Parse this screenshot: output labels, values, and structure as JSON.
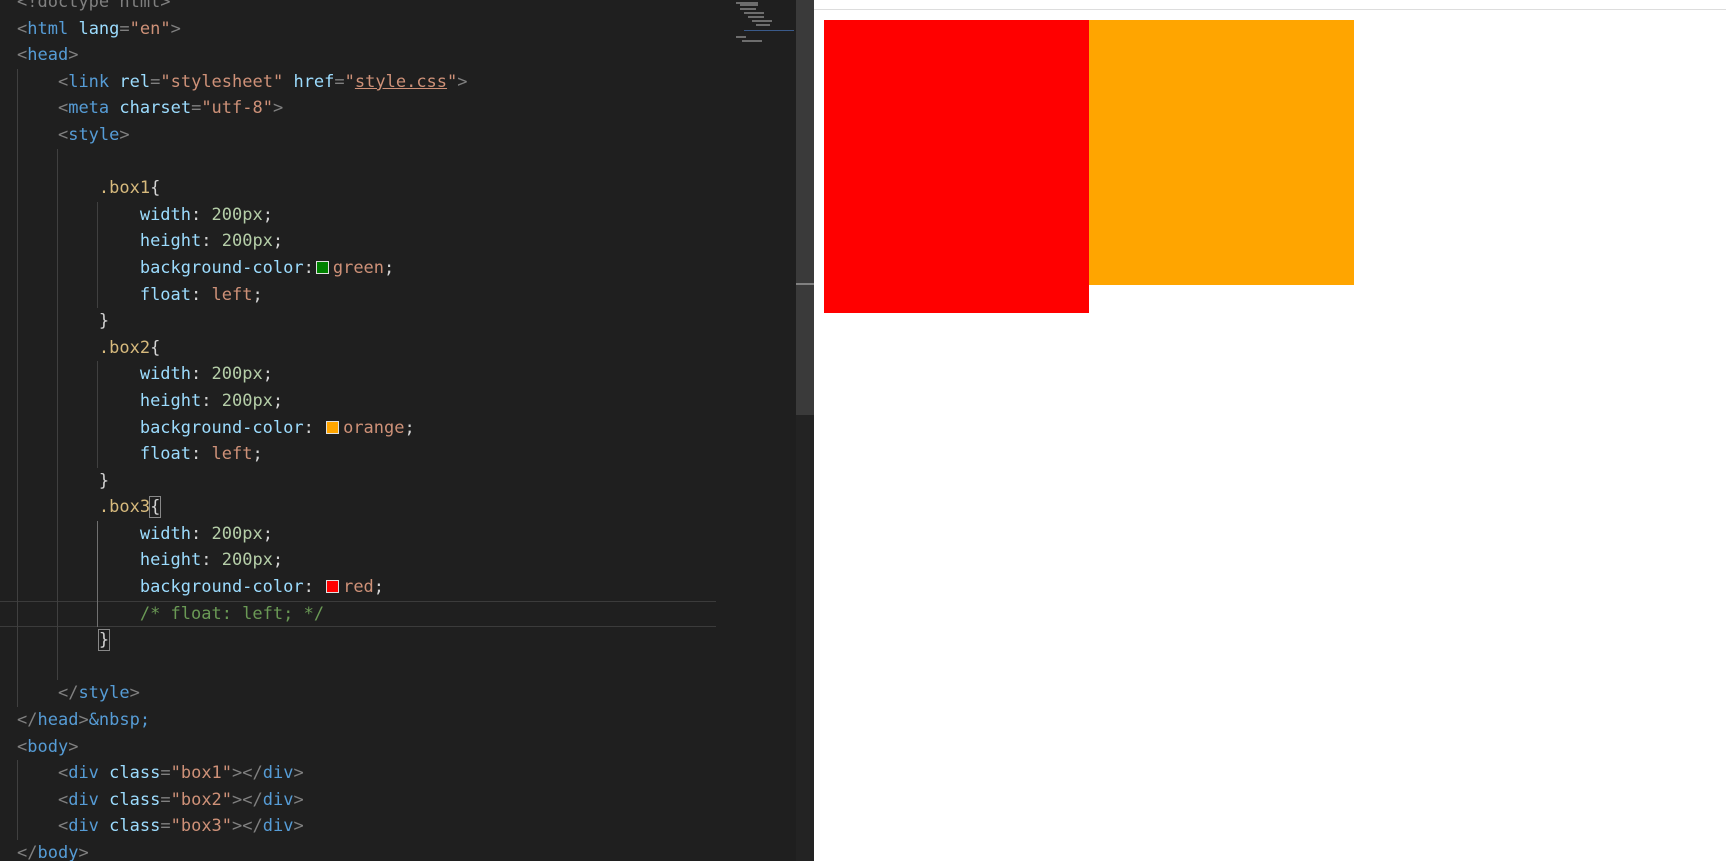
{
  "editor": {
    "lines": [
      [
        {
          "t": "<!doctype html>",
          "c": "tag-b"
        }
      ],
      [
        {
          "t": "<",
          "c": "tag-b"
        },
        {
          "t": "html",
          "c": "tag"
        },
        {
          "t": " "
        },
        {
          "t": "lang",
          "c": "attr"
        },
        {
          "t": "=",
          "c": "tag-b"
        },
        {
          "t": "\"en\"",
          "c": "val"
        },
        {
          "t": ">",
          "c": "tag-b"
        }
      ],
      [
        {
          "t": "<",
          "c": "tag-b"
        },
        {
          "t": "head",
          "c": "tag"
        },
        {
          "t": ">",
          "c": "tag-b"
        }
      ],
      [
        {
          "t": "    "
        },
        {
          "t": "<",
          "c": "tag-b"
        },
        {
          "t": "link",
          "c": "tag"
        },
        {
          "t": " "
        },
        {
          "t": "rel",
          "c": "attr"
        },
        {
          "t": "=",
          "c": "tag-b"
        },
        {
          "t": "\"stylesheet\"",
          "c": "val"
        },
        {
          "t": " "
        },
        {
          "t": "href",
          "c": "attr"
        },
        {
          "t": "=",
          "c": "tag-b"
        },
        {
          "t": "\"",
          "c": "val"
        },
        {
          "t": "style.css",
          "c": "val link-u"
        },
        {
          "t": "\"",
          "c": "val"
        },
        {
          "t": ">",
          "c": "tag-b"
        }
      ],
      [
        {
          "t": "    "
        },
        {
          "t": "<",
          "c": "tag-b"
        },
        {
          "t": "meta",
          "c": "tag"
        },
        {
          "t": " "
        },
        {
          "t": "charset",
          "c": "attr"
        },
        {
          "t": "=",
          "c": "tag-b"
        },
        {
          "t": "\"utf-8\"",
          "c": "val"
        },
        {
          "t": ">",
          "c": "tag-b"
        }
      ],
      [
        {
          "t": "    "
        },
        {
          "t": "<",
          "c": "tag-b"
        },
        {
          "t": "style",
          "c": "tag"
        },
        {
          "t": ">",
          "c": "tag-b"
        }
      ],
      [
        {
          "t": ""
        }
      ],
      [
        {
          "t": "        "
        },
        {
          "t": ".box1",
          "c": "sel"
        },
        {
          "t": "{",
          "c": "brace"
        }
      ],
      [
        {
          "t": "            "
        },
        {
          "t": "width",
          "c": "prop"
        },
        {
          "t": ": "
        },
        {
          "t": "200px",
          "c": "num"
        },
        {
          "t": ";"
        }
      ],
      [
        {
          "t": "            "
        },
        {
          "t": "height",
          "c": "prop"
        },
        {
          "t": ": "
        },
        {
          "t": "200px",
          "c": "num"
        },
        {
          "t": ";"
        }
      ],
      [
        {
          "t": "            "
        },
        {
          "t": "background-color",
          "c": "prop"
        },
        {
          "t": ":"
        },
        {
          "sw": "#008000"
        },
        {
          "t": "green",
          "c": "kw"
        },
        {
          "t": ";"
        }
      ],
      [
        {
          "t": "            "
        },
        {
          "t": "float",
          "c": "prop"
        },
        {
          "t": ": "
        },
        {
          "t": "left",
          "c": "kw"
        },
        {
          "t": ";"
        }
      ],
      [
        {
          "t": "        "
        },
        {
          "t": "}",
          "c": "brace"
        }
      ],
      [
        {
          "t": "        "
        },
        {
          "t": ".box2",
          "c": "sel"
        },
        {
          "t": "{",
          "c": "brace"
        }
      ],
      [
        {
          "t": "            "
        },
        {
          "t": "width",
          "c": "prop"
        },
        {
          "t": ": "
        },
        {
          "t": "200px",
          "c": "num"
        },
        {
          "t": ";"
        }
      ],
      [
        {
          "t": "            "
        },
        {
          "t": "height",
          "c": "prop"
        },
        {
          "t": ": "
        },
        {
          "t": "200px",
          "c": "num"
        },
        {
          "t": ";"
        }
      ],
      [
        {
          "t": "            "
        },
        {
          "t": "background-color",
          "c": "prop"
        },
        {
          "t": ": "
        },
        {
          "sw": "#ffa500"
        },
        {
          "t": "orange",
          "c": "kw"
        },
        {
          "t": ";"
        }
      ],
      [
        {
          "t": "            "
        },
        {
          "t": "float",
          "c": "prop"
        },
        {
          "t": ": "
        },
        {
          "t": "left",
          "c": "kw"
        },
        {
          "t": ";"
        }
      ],
      [
        {
          "t": "        "
        },
        {
          "t": "}",
          "c": "brace"
        }
      ],
      [
        {
          "t": "        "
        },
        {
          "t": ".box3",
          "c": "sel"
        },
        {
          "t": "{",
          "c": "brace matched"
        }
      ],
      [
        {
          "t": "            "
        },
        {
          "t": "width",
          "c": "prop"
        },
        {
          "t": ": "
        },
        {
          "t": "200px",
          "c": "num"
        },
        {
          "t": ";"
        }
      ],
      [
        {
          "t": "            "
        },
        {
          "t": "height",
          "c": "prop"
        },
        {
          "t": ": "
        },
        {
          "t": "200px",
          "c": "num"
        },
        {
          "t": ";"
        }
      ],
      [
        {
          "t": "            "
        },
        {
          "t": "background-color",
          "c": "prop"
        },
        {
          "t": ": "
        },
        {
          "sw": "#ff0000"
        },
        {
          "t": "red",
          "c": "kw"
        },
        {
          "t": ";"
        }
      ],
      [
        {
          "t": "            "
        },
        {
          "t": "/* float: left; */",
          "c": "comment"
        }
      ],
      [
        {
          "t": "        "
        },
        {
          "t": "}",
          "c": "brace matched"
        }
      ],
      [
        {
          "t": ""
        }
      ],
      [
        {
          "t": "    "
        },
        {
          "t": "</",
          "c": "tag-b"
        },
        {
          "t": "style",
          "c": "tag"
        },
        {
          "t": ">",
          "c": "tag-b"
        }
      ],
      [
        {
          "t": "</",
          "c": "tag-b"
        },
        {
          "t": "head",
          "c": "tag"
        },
        {
          "t": ">",
          "c": "tag-b"
        },
        {
          "t": "&nbsp;",
          "c": "tag"
        }
      ],
      [
        {
          "t": "<",
          "c": "tag-b"
        },
        {
          "t": "body",
          "c": "tag"
        },
        {
          "t": ">",
          "c": "tag-b"
        }
      ],
      [
        {
          "t": "    "
        },
        {
          "t": "<",
          "c": "tag-b"
        },
        {
          "t": "div",
          "c": "tag"
        },
        {
          "t": " "
        },
        {
          "t": "class",
          "c": "attr"
        },
        {
          "t": "=",
          "c": "tag-b"
        },
        {
          "t": "\"box1\"",
          "c": "val"
        },
        {
          "t": "></",
          "c": "tag-b"
        },
        {
          "t": "div",
          "c": "tag"
        },
        {
          "t": ">",
          "c": "tag-b"
        }
      ],
      [
        {
          "t": "    "
        },
        {
          "t": "<",
          "c": "tag-b"
        },
        {
          "t": "div",
          "c": "tag"
        },
        {
          "t": " "
        },
        {
          "t": "class",
          "c": "attr"
        },
        {
          "t": "=",
          "c": "tag-b"
        },
        {
          "t": "\"box2\"",
          "c": "val"
        },
        {
          "t": "></",
          "c": "tag-b"
        },
        {
          "t": "div",
          "c": "tag"
        },
        {
          "t": ">",
          "c": "tag-b"
        }
      ],
      [
        {
          "t": "    "
        },
        {
          "t": "<",
          "c": "tag-b"
        },
        {
          "t": "div",
          "c": "tag"
        },
        {
          "t": " "
        },
        {
          "t": "class",
          "c": "attr"
        },
        {
          "t": "=",
          "c": "tag-b"
        },
        {
          "t": "\"box3\"",
          "c": "val"
        },
        {
          "t": "></",
          "c": "tag-b"
        },
        {
          "t": "div",
          "c": "tag"
        },
        {
          "t": ">",
          "c": "tag-b"
        }
      ],
      [
        {
          "t": "</",
          "c": "tag-b"
        },
        {
          "t": "body",
          "c": "tag"
        },
        {
          "t": ">",
          "c": "tag-b"
        }
      ]
    ],
    "current_line": 23,
    "theme": {
      "background": "#1f1f1f"
    }
  },
  "preview": {
    "background": "#ffffff",
    "boxes": [
      {
        "name": "box1",
        "color": "#008000"
      },
      {
        "name": "box2",
        "color": "#ffa500"
      },
      {
        "name": "box3",
        "color": "#ff0000"
      }
    ]
  }
}
